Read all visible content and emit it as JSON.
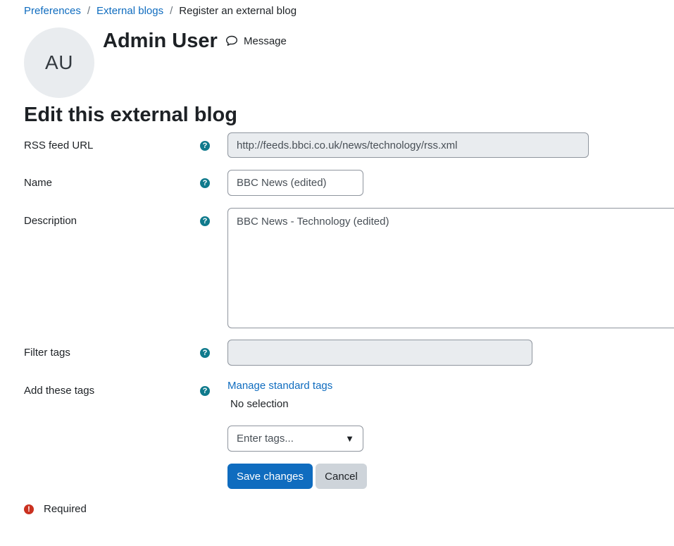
{
  "breadcrumb": {
    "items": [
      {
        "label": "Preferences"
      },
      {
        "label": "External blogs"
      },
      {
        "label": "Register an external blog"
      }
    ],
    "separator": "/"
  },
  "header": {
    "avatar_initials": "AU",
    "user_name": "Admin User",
    "message_label": "Message"
  },
  "page_title": "Edit this external blog",
  "form": {
    "rss_feed_url": {
      "label": "RSS feed URL",
      "value": "http://feeds.bbci.co.uk/news/technology/rss.xml"
    },
    "name": {
      "label": "Name",
      "value": "BBC News (edited)"
    },
    "description": {
      "label": "Description",
      "value": "BBC News - Technology (edited)"
    },
    "filter_tags": {
      "label": "Filter tags",
      "value": ""
    },
    "add_tags": {
      "label": "Add these tags",
      "manage_link": "Manage standard tags",
      "selection_text": "No selection",
      "placeholder": "Enter tags...",
      "dropdown_arrow": "▼"
    },
    "help_icon_glyph": "?",
    "save_label": "Save changes",
    "cancel_label": "Cancel",
    "required_glyph": "!",
    "required_label": "Required"
  },
  "colors": {
    "link": "#0f6cbf",
    "primary_button": "#0f6cbf",
    "secondary_button": "#ced4da",
    "help_icon": "#0f7a8c",
    "required_icon": "#ca3120"
  }
}
